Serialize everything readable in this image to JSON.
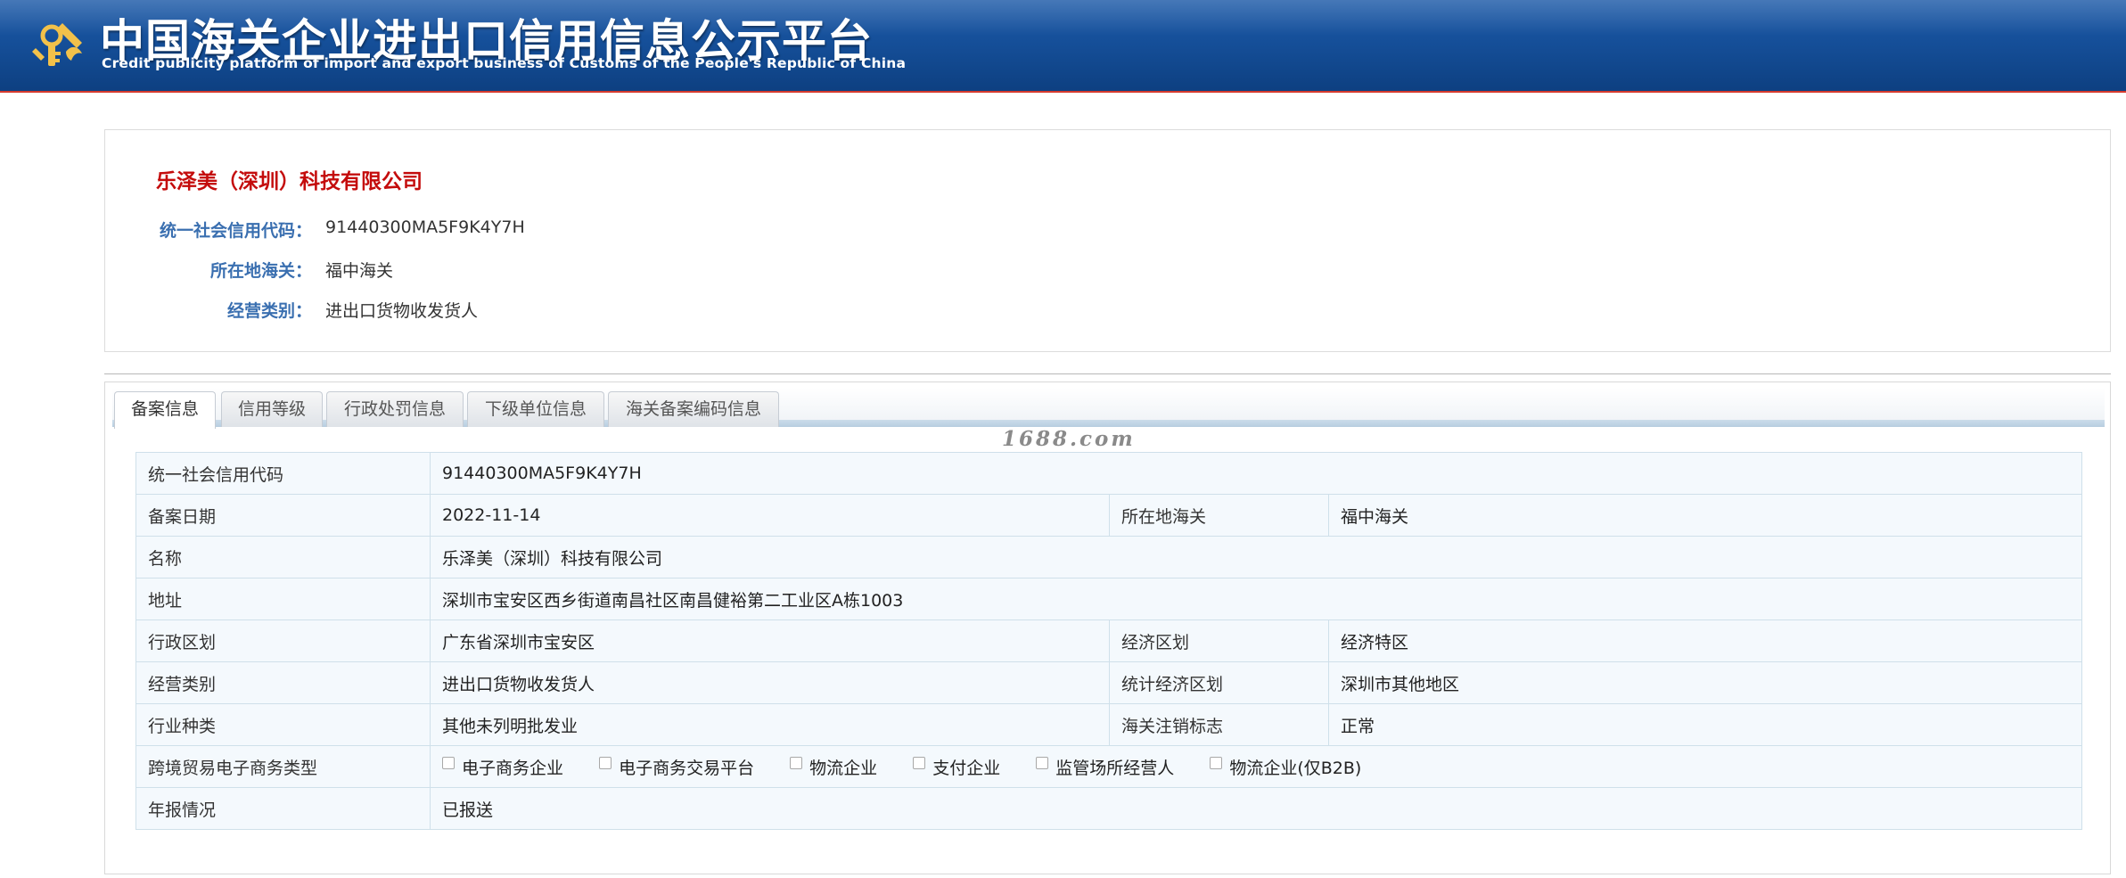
{
  "header": {
    "title": "中国海关企业进出口信用信息公示平台",
    "subtitle": "Credit publicity platform of import and export business of Customs of the People's Republic of China",
    "logo_icon": "customs-emblem-icon"
  },
  "company": {
    "name": "乐泽美（深圳）科技有限公司",
    "fields": [
      {
        "label": "统一社会信用代码：",
        "value": "91440300MA5F9K4Y7H"
      },
      {
        "label": "所在地海关：",
        "value": "福中海关"
      },
      {
        "label": "经营类别：",
        "value": "进出口货物收发货人"
      }
    ]
  },
  "tabs": [
    {
      "label": "备案信息",
      "active": true
    },
    {
      "label": "信用等级",
      "active": false
    },
    {
      "label": "行政处罚信息",
      "active": false
    },
    {
      "label": "下级单位信息",
      "active": false
    },
    {
      "label": "海关备案编码信息",
      "active": false
    }
  ],
  "watermark": "1688.com",
  "record": {
    "credit_code_label": "统一社会信用代码",
    "credit_code": "91440300MA5F9K4Y7H",
    "record_date_label": "备案日期",
    "record_date": "2022-11-14",
    "customs_label": "所在地海关",
    "customs": "福中海关",
    "name_label": "名称",
    "name": "乐泽美（深圳）科技有限公司",
    "address_label": "地址",
    "address": "深圳市宝安区西乡街道南昌社区南昌健裕第二工业区A栋1003",
    "admin_region_label": "行政区划",
    "admin_region": "广东省深圳市宝安区",
    "econ_region_label": "经济区划",
    "econ_region": "经济特区",
    "biz_type_label": "经营类别",
    "biz_type": "进出口货物收发货人",
    "stat_region_label": "统计经济区划",
    "stat_region": "深圳市其他地区",
    "industry_label": "行业种类",
    "industry": "其他未列明批发业",
    "cancel_flag_label": "海关注销标志",
    "cancel_flag": "正常",
    "ecommerce_label": "跨境贸易电子商务类型",
    "ecommerce_options": [
      "电子商务企业",
      "电子商务交易平台",
      "物流企业",
      "支付企业",
      "监管场所经营人",
      "物流企业(仅B2B)"
    ],
    "annual_label": "年报情况",
    "annual": "已报送"
  }
}
